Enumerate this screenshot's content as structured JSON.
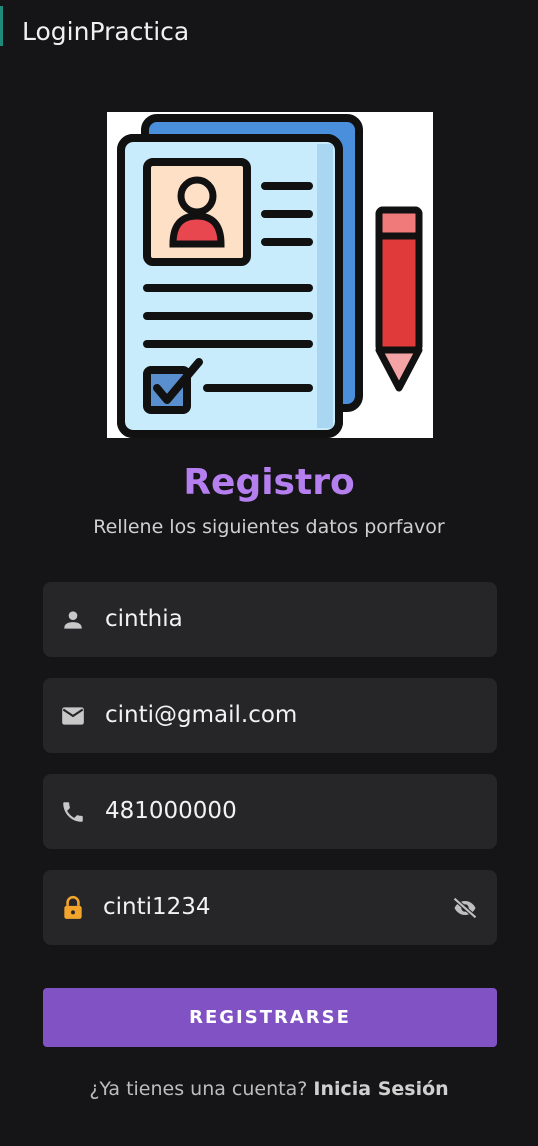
{
  "appbar": {
    "title": "LoginPractica"
  },
  "hero": {
    "icon": "registration-document-pencil-illustration"
  },
  "heading": "Registro",
  "subtitle": "Rellene los siguientes datos porfavor",
  "form": {
    "name": {
      "value": "cinthia",
      "icon": "person-icon"
    },
    "email": {
      "value": "cinti@gmail.com",
      "icon": "mail-icon"
    },
    "phone": {
      "value": "481000000",
      "icon": "phone-icon"
    },
    "password": {
      "value": "cinti1234",
      "icon": "lock-icon",
      "toggle_icon": "visibility-off-icon"
    }
  },
  "button": {
    "label": "REGISTRARSE"
  },
  "footer": {
    "prompt": "¿Ya tienes una cuenta? ",
    "link": "Inicia Sesión"
  },
  "colors": {
    "background": "#151416",
    "field": "#262528",
    "accent_heading": "#b57ff0",
    "button": "#8152c4",
    "lock_icon": "#f2a52c"
  }
}
